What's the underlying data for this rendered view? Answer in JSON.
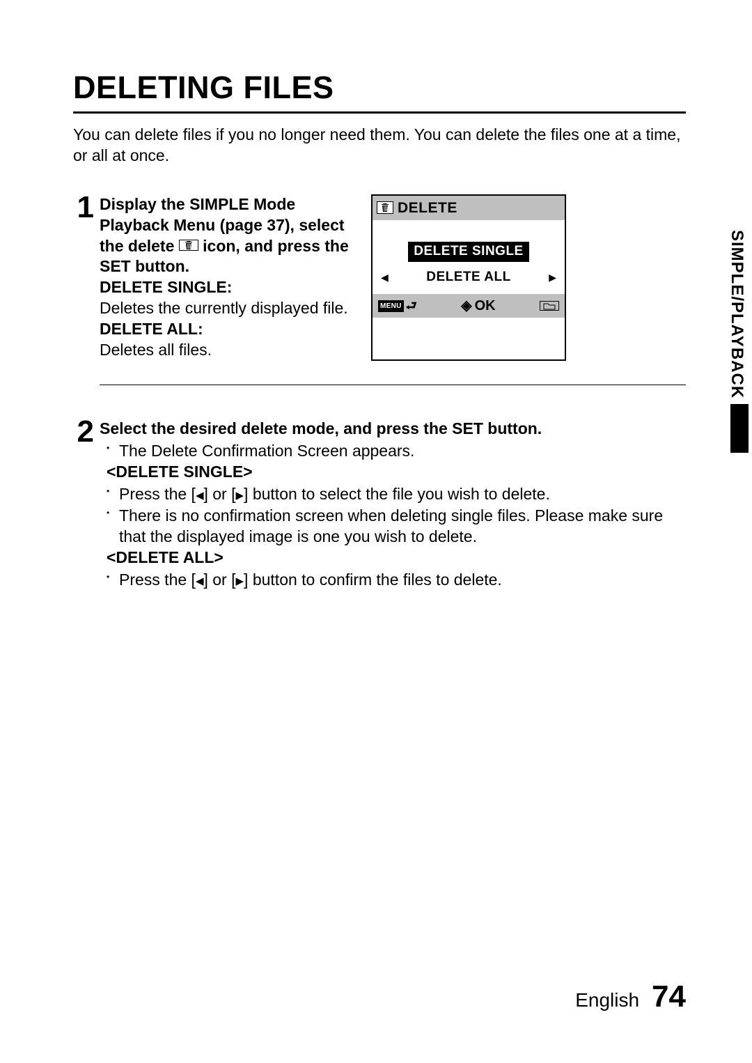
{
  "title": "DELETING FILES",
  "intro": "You can delete files if you no longer need them. You can delete the files one at a time, or all at once.",
  "side_tab": "SIMPLE/PLAYBACK",
  "footer": {
    "lang": "English",
    "page": "74"
  },
  "step1": {
    "num": "1",
    "line_a": "Display the SIMPLE Mode Playback Menu (page 37), select the delete",
    "line_b": "icon, and press the SET button.",
    "ds_label": "DELETE SINGLE:",
    "ds_text": "Deletes the currently displayed file.",
    "da_label": "DELETE ALL:",
    "da_text": "Deletes all files."
  },
  "lcd": {
    "header": "DELETE",
    "opt_single": "DELETE SINGLE",
    "opt_all": "DELETE ALL",
    "menu": "MENU",
    "ok": "OK"
  },
  "step2": {
    "num": "2",
    "heading": "Select the desired delete mode, and press the SET button.",
    "b1": "The Delete Confirmation Screen appears.",
    "ds_heading": "<DELETE SINGLE>",
    "ds_b1_a": "Press the [",
    "ds_b1_b": "] or [",
    "ds_b1_c": "] button to select the file you wish to delete.",
    "ds_b2": "There is no confirmation screen when deleting single files. Please make sure that the displayed image is one you wish to delete.",
    "da_heading": "<DELETE ALL>",
    "da_b1_a": "Press the [",
    "da_b1_b": "] or [",
    "da_b1_c": "] button to confirm the files to delete."
  }
}
